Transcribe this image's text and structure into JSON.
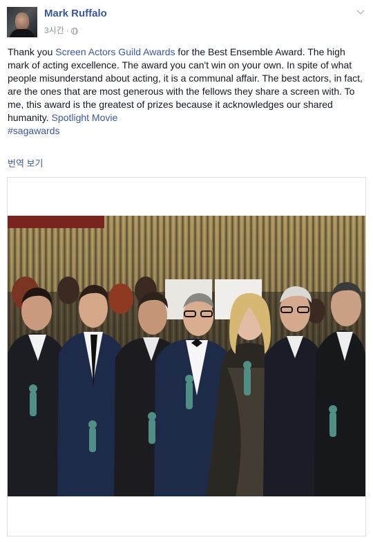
{
  "post": {
    "author": "Mark Ruffalo",
    "timestamp": "3시간",
    "separator": "·",
    "privacy_icon": "globe-icon",
    "menu_icon": "chevron-down-icon",
    "text": {
      "part1": "Thank you ",
      "link1": "Screen Actors Guild Awards",
      "part2": " for the Best Ensemble Award. The high mark of acting excellence. The award you can't win on your own. In spite of what people misunderstand about acting, it is a communal affair. The best actors, in fact, are the ones that are most generous with the fellows they share a screen with. To me, this award is the greatest of prizes because it acknowledges our shared humanity. ",
      "link2": "Spotlight Movie",
      "part3": " ",
      "hashtag": "#sagawards"
    },
    "translate_label": "번역 보기"
  },
  "colors": {
    "link": "#3b5998",
    "text": "#141823",
    "meta": "#90949c",
    "border": "#dddfe2",
    "curtain": "#8a7a4c",
    "statuette": "#4f8f86"
  }
}
